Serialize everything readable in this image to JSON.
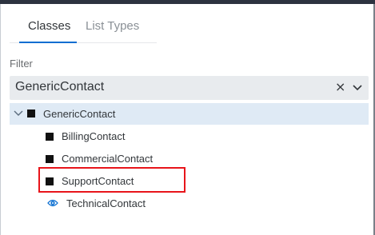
{
  "tabs": [
    {
      "label": "Classes",
      "active": true
    },
    {
      "label": "List Types",
      "active": false
    }
  ],
  "filter": {
    "label": "Filter",
    "value": "GenericContact"
  },
  "icons": {
    "clear": "×",
    "dropdown": "chevron-down-icon",
    "expand": "chevron-down-icon",
    "class": "square-icon",
    "custom_class": "eye-icon"
  },
  "tree": {
    "root": {
      "label": "GenericContact",
      "expanded": true
    },
    "children": [
      {
        "label": "BillingContact",
        "icon": "square-icon"
      },
      {
        "label": "CommercialContact",
        "icon": "square-icon"
      },
      {
        "label": "SupportContact",
        "icon": "square-icon",
        "highlighted": true
      },
      {
        "label": "TechnicalContact",
        "icon": "eye-icon"
      }
    ]
  },
  "colors": {
    "accent": "#0a6ed1",
    "selected_row": "#dfeaf5",
    "highlight": "#e8141a",
    "input_bg": "#e8ebee"
  }
}
